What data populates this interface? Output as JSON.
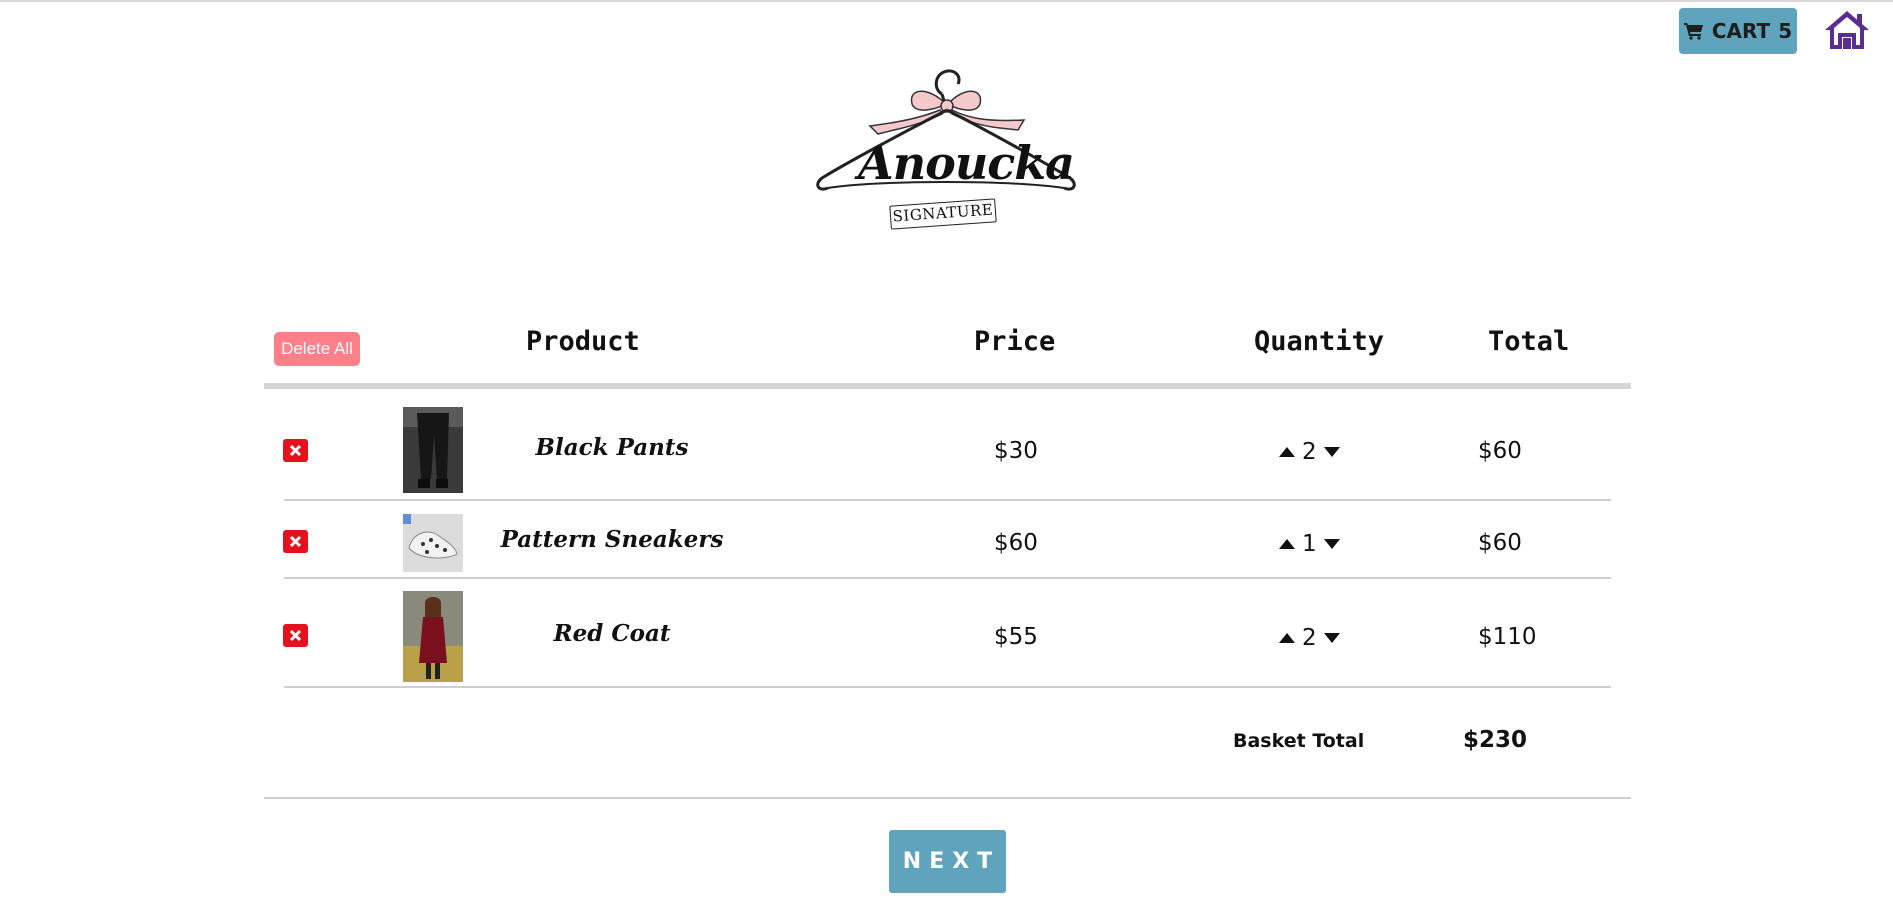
{
  "header": {
    "cart_label": "CART",
    "cart_count": "5",
    "icons": {
      "cart": "shopping-cart-icon",
      "home": "home-icon"
    },
    "colors": {
      "cart_button": "#5fa3bd",
      "home_icon": "#5b2d91"
    }
  },
  "logo": {
    "brand": "Anoucka",
    "sub": "SIGNATURE",
    "colors": {
      "bow": "#f3c9cc",
      "ink": "#111111"
    }
  },
  "table": {
    "delete_all_label": "Delete All",
    "headers": {
      "product": "Product",
      "price": "Price",
      "quantity": "Quantity",
      "total": "Total"
    },
    "items": [
      {
        "name": "Black Pants",
        "price": "$30",
        "quantity": "2",
        "total": "$60"
      },
      {
        "name": "Pattern Sneakers",
        "price": "$60",
        "quantity": "1",
        "total": "$60"
      },
      {
        "name": "Red Coat",
        "price": "$55",
        "quantity": "2",
        "total": "$110"
      }
    ]
  },
  "basket": {
    "label": "Basket Total",
    "total": "$230"
  },
  "next_label": "NEXT",
  "colors": {
    "delete_all": "#ff7f8a",
    "remove_item": "#e3121d",
    "next_button": "#5fa3bd"
  }
}
